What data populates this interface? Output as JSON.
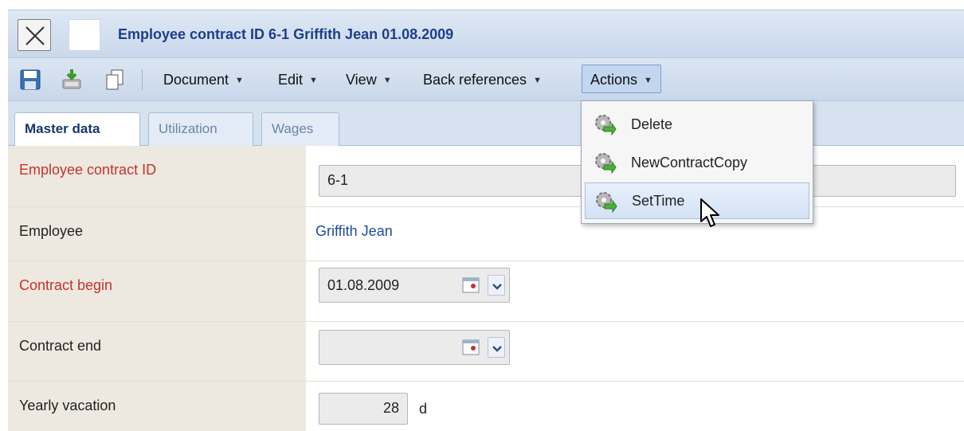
{
  "window": {
    "title": "Employee contract ID 6-1 Griffith Jean 01.08.2009"
  },
  "toolbar": {
    "icons": [
      "save-icon",
      "export-icon",
      "copy-icon"
    ],
    "menus": [
      {
        "label": "Document"
      },
      {
        "label": "Edit"
      },
      {
        "label": "View"
      },
      {
        "label": "Back references"
      },
      {
        "label": "Actions"
      }
    ]
  },
  "tabs": [
    {
      "label": "Master data",
      "active": true
    },
    {
      "label": "Utilization",
      "active": false
    },
    {
      "label": "Wages",
      "active": false
    }
  ],
  "form": {
    "contract_id": {
      "label": "Employee contract ID",
      "value": "6-1",
      "required": true
    },
    "employee": {
      "label": "Employee",
      "value": "Griffith Jean"
    },
    "contract_begin": {
      "label": "Contract begin",
      "value": "01.08.2009",
      "required": true
    },
    "contract_end": {
      "label": "Contract end",
      "value": ""
    },
    "yearly_vacation": {
      "label": "Yearly vacation",
      "value": "28",
      "unit": "d"
    }
  },
  "actions_menu": {
    "items": [
      {
        "label": "Delete"
      },
      {
        "label": "NewContractCopy"
      },
      {
        "label": "SetTime",
        "hovered": true
      }
    ]
  },
  "colors": {
    "required_label": "#c4332b",
    "link": "#1d4b9a",
    "title": "#1c3f8a"
  }
}
